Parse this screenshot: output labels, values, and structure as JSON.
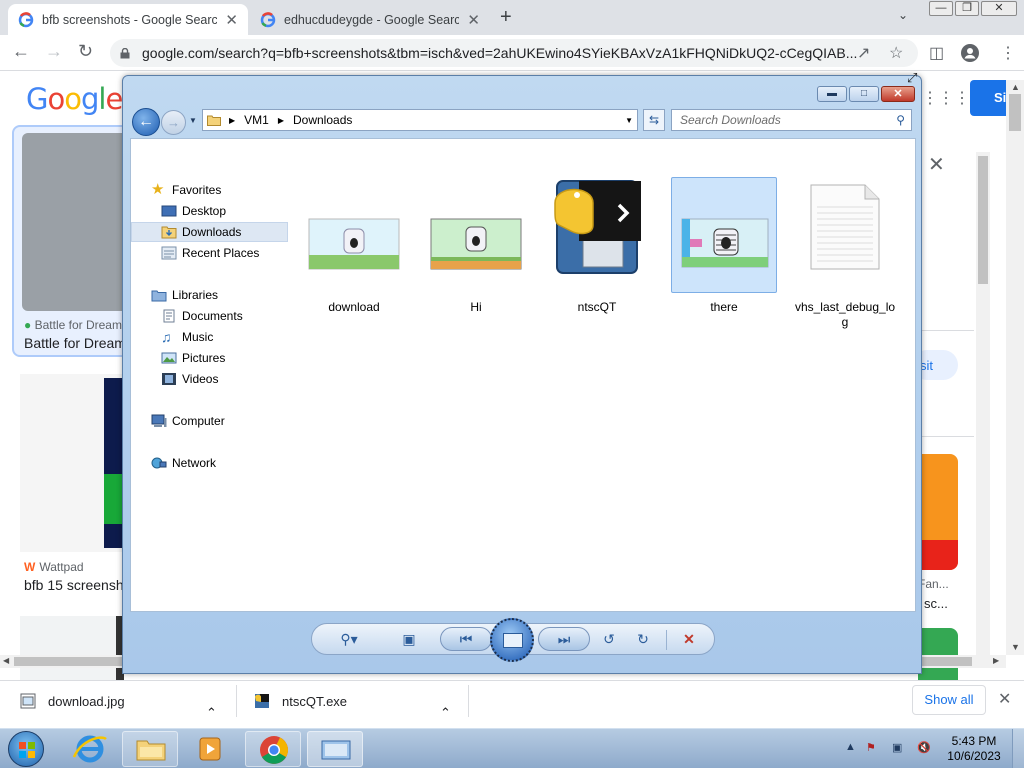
{
  "browser": {
    "tabs": [
      {
        "title": "bfb screenshots - Google Search",
        "active": true
      },
      {
        "title": "edhucdudeygde - Google Search",
        "active": false
      }
    ],
    "new_tab_glyph": "+",
    "tab_close_glyph": "✕",
    "url": "google.com/search?q=bfb+screenshots&tbm=isch&ved=2ahUKEwino4SYieKBAxVzA1kFHQNiDkUQ2-cCegQIAB...",
    "window_controls": {
      "minimize": "—",
      "restore": "❐",
      "close": "✕"
    }
  },
  "google": {
    "logo": [
      "G",
      "o",
      "o",
      "g",
      "l",
      "e"
    ],
    "sign_in_label": "Si",
    "results": [
      {
        "source": "Battle for Dream",
        "title": "Battle for Dream"
      },
      {
        "source": "Wattpad",
        "title": "bfb 15 screensh"
      }
    ],
    "side_panel": {
      "visit_label": "sit",
      "fan_text": "Fan...",
      "sc_text": "sc..."
    }
  },
  "explorer": {
    "path": [
      "VM1",
      "Downloads"
    ],
    "search_placeholder": "Search Downloads",
    "nav": {
      "favorites_label": "Favorites",
      "favorites": [
        "Desktop",
        "Downloads",
        "Recent Places"
      ],
      "libraries_label": "Libraries",
      "libraries": [
        "Documents",
        "Music",
        "Pictures",
        "Videos"
      ],
      "computer_label": "Computer",
      "network_label": "Network"
    },
    "files": [
      {
        "name": "download",
        "selected": false
      },
      {
        "name": "Hi",
        "selected": false
      },
      {
        "name": "ntscQT",
        "selected": false
      },
      {
        "name": "there",
        "selected": true
      },
      {
        "name": "vhs_last_debug_log",
        "selected": false
      }
    ],
    "colors": {
      "selection": "#cde4fb",
      "frame": "#b3d0ee"
    }
  },
  "downloads_bar": {
    "items": [
      "download.jpg",
      "ntscQT.exe"
    ],
    "show_all_label": "Show all"
  },
  "taskbar": {
    "time": "5:43 PM",
    "date": "10/6/2023"
  }
}
